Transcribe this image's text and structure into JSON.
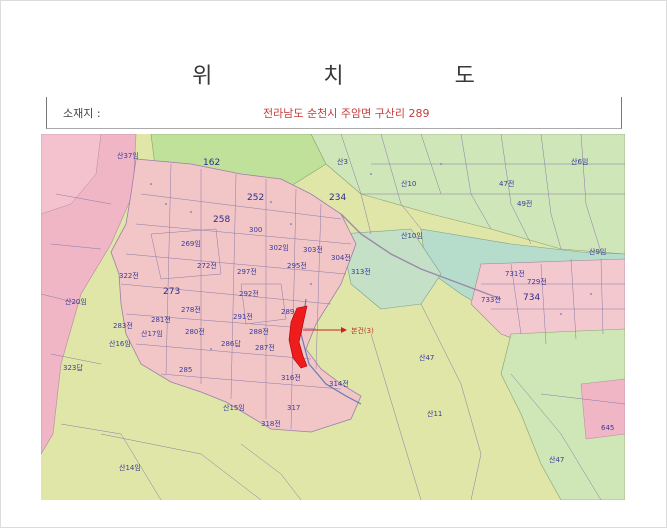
{
  "title": "위 치 도",
  "address": {
    "label": "소재지 :",
    "value": "전라남도 순천시 주암면 구산리 289"
  },
  "map": {
    "target_label": "본건(3)",
    "colors": {
      "base": "#dfe6a8",
      "village": "#f2c9c9",
      "green": "#c0dfa0",
      "forest_pink": "#f0b6c6",
      "teal": "#b4dccd",
      "target": "#ee1c1c",
      "parcel_line": "#8a7aa8"
    },
    "parcels": [
      {
        "id": "p1",
        "text": "산37임"
      },
      {
        "id": "p2",
        "text": "162"
      },
      {
        "id": "p3",
        "text": "252"
      },
      {
        "id": "p4",
        "text": "258"
      },
      {
        "id": "p5",
        "text": "234"
      },
      {
        "id": "p6",
        "text": "269임"
      },
      {
        "id": "p7",
        "text": "300"
      },
      {
        "id": "p8",
        "text": "302임"
      },
      {
        "id": "p9",
        "text": "303전"
      },
      {
        "id": "p10",
        "text": "322전"
      },
      {
        "id": "p11",
        "text": "273"
      },
      {
        "id": "p12",
        "text": "산20임"
      },
      {
        "id": "p13",
        "text": "272전"
      },
      {
        "id": "p14",
        "text": "297전"
      },
      {
        "id": "p15",
        "text": "295전"
      },
      {
        "id": "p16",
        "text": "292전"
      },
      {
        "id": "p17",
        "text": "291전"
      },
      {
        "id": "p18",
        "text": "289"
      },
      {
        "id": "p19",
        "text": "288전"
      },
      {
        "id": "p20",
        "text": "287전"
      },
      {
        "id": "p21",
        "text": "286답"
      },
      {
        "id": "p22",
        "text": "280전"
      },
      {
        "id": "p23",
        "text": "278전"
      },
      {
        "id": "p24",
        "text": "281전"
      },
      {
        "id": "p25",
        "text": "283전"
      },
      {
        "id": "p26",
        "text": "산17임"
      },
      {
        "id": "p27",
        "text": "산16임"
      },
      {
        "id": "p28",
        "text": "285"
      },
      {
        "id": "p29",
        "text": "316전"
      },
      {
        "id": "p30",
        "text": "314전"
      },
      {
        "id": "p31",
        "text": "317"
      },
      {
        "id": "p32",
        "text": "산15임"
      },
      {
        "id": "p33",
        "text": "318전"
      },
      {
        "id": "p34",
        "text": "323답"
      },
      {
        "id": "p35",
        "text": "산14임"
      },
      {
        "id": "p36",
        "text": "산10임"
      },
      {
        "id": "p37",
        "text": "734"
      },
      {
        "id": "p38",
        "text": "729전"
      },
      {
        "id": "p39",
        "text": "733전"
      },
      {
        "id": "p40",
        "text": "731전"
      },
      {
        "id": "p41",
        "text": "산6임"
      },
      {
        "id": "p42",
        "text": "산9임"
      },
      {
        "id": "p43",
        "text": "산47"
      },
      {
        "id": "p44",
        "text": "산11"
      },
      {
        "id": "p45",
        "text": "645"
      },
      {
        "id": "p46",
        "text": "산47"
      },
      {
        "id": "p47",
        "text": "산3"
      },
      {
        "id": "p48",
        "text": "산10"
      },
      {
        "id": "p49",
        "text": "313전"
      },
      {
        "id": "p50",
        "text": "304전"
      },
      {
        "id": "p51",
        "text": "49전"
      },
      {
        "id": "p52",
        "text": "47전"
      }
    ]
  }
}
